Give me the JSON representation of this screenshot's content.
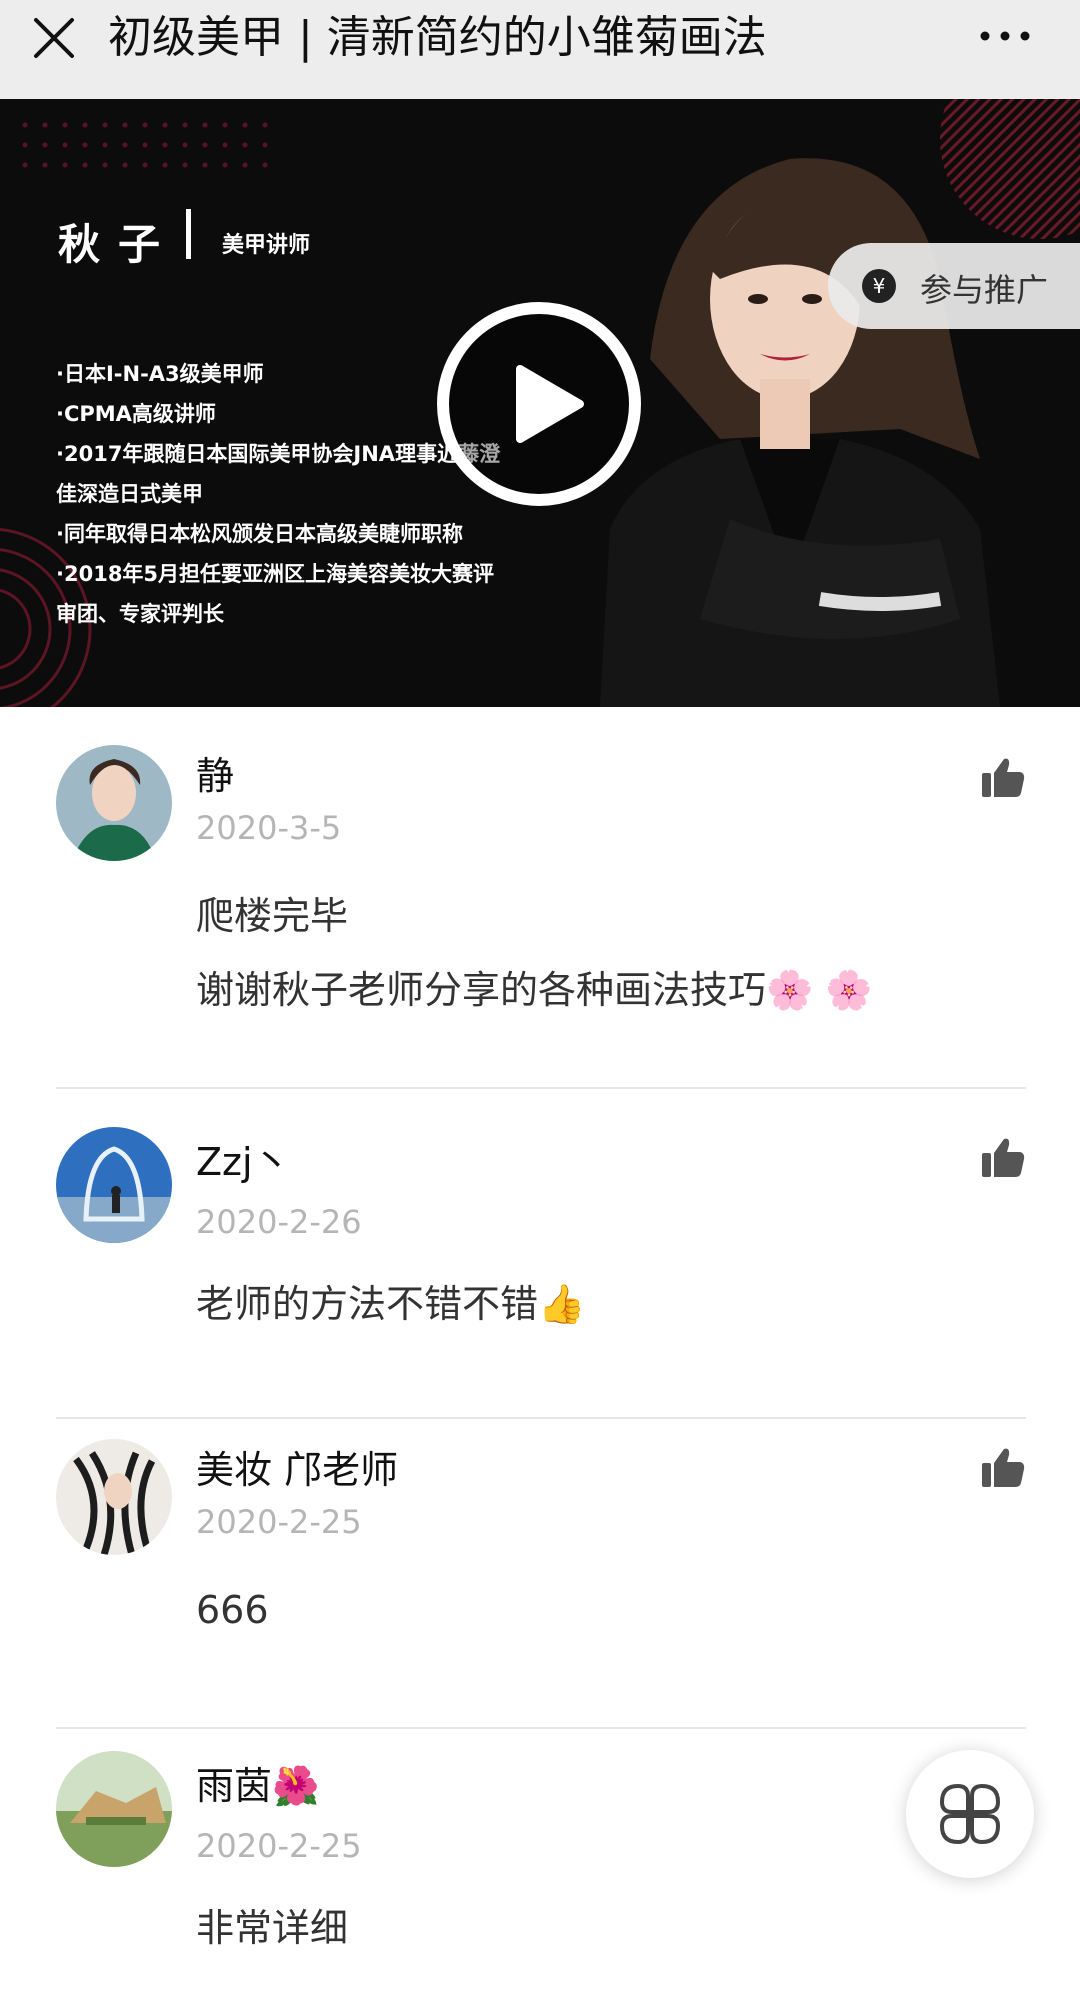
{
  "topbar": {
    "title": "初级美甲 | 清新简约的小雏菊画法",
    "close_icon": "close-icon",
    "more_icon": "more-icon"
  },
  "banner": {
    "teacher_name": "秋子",
    "teacher_role": "美甲讲师",
    "bio": [
      "·日本I-N-A3级美甲师",
      "·CPMA高级讲师",
      "·2017年跟随日本国际美甲协会JNA理事近藤澄",
      "佳深造日式美甲",
      "·同年取得日本松风颁发日本高级美睫师职称",
      "·2018年5月担任要亚洲区上海美容美妆大赛评",
      "审团、专家评判长"
    ],
    "promo_label": "参与推广",
    "promo_icon": "¥"
  },
  "comments": [
    {
      "name": "静",
      "date": "2020-3-5",
      "lines": [
        "爬楼完毕",
        "谢谢秋子老师分享的各种画法技巧🌸 🌸"
      ]
    },
    {
      "name": "Zzj丶",
      "date": "2020-2-26",
      "lines": [
        "老师的方法不错不错👍"
      ]
    },
    {
      "name": "美妆 邝老师",
      "date": "2020-2-25",
      "lines": [
        "666"
      ]
    },
    {
      "name": "雨茵🌺",
      "date": "2020-2-25",
      "lines": [
        "非常详细"
      ]
    }
  ],
  "colors": {
    "topbar_bg": "#ededed",
    "banner_bg": "#0c0c0d",
    "accent_red": "#b0213a",
    "date_gray": "#b5b5b5"
  }
}
